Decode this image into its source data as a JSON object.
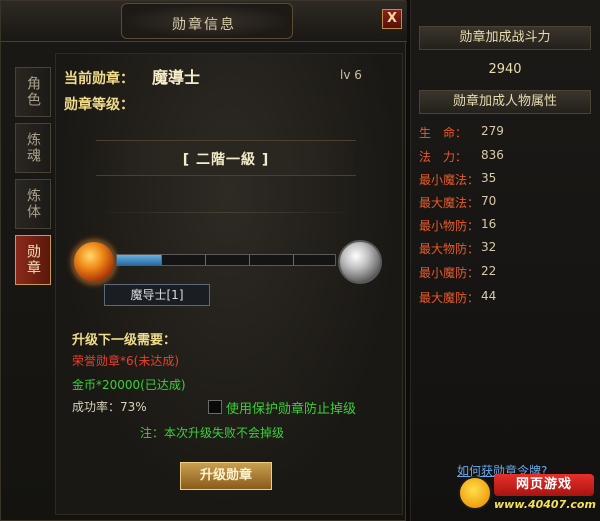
{
  "window": {
    "title": "勋章信息",
    "close_label": "X"
  },
  "tabs": [
    {
      "label": "角色",
      "active": false
    },
    {
      "label": "炼魂",
      "active": false
    },
    {
      "label": "炼体",
      "active": false
    },
    {
      "label": "勋章",
      "active": true
    }
  ],
  "medal": {
    "current_label": "当前勋章：",
    "name": "魔導士",
    "level": "lv 6",
    "level_label": "勋章等级：",
    "rank": "[ 二階一級 ]",
    "progress_fraction": 0.2,
    "progress_tooltip": "魔导士[1]"
  },
  "requirements": {
    "title": "升级下一级需要：",
    "items": [
      {
        "text": "荣誉勋章*6(未达成)",
        "status": "unmet"
      },
      {
        "text": "金币*20000(已达成)",
        "status": "met"
      }
    ],
    "success_rate": "成功率：73%",
    "protect_label": "使用保护勋章防止掉级",
    "protect_checked": false,
    "note": "注：本次升级失败不会掉级",
    "upgrade_button": "升级勋章"
  },
  "right_panel": {
    "power_header": "勋章加成战斗力",
    "power_value": "2940",
    "attr_header": "勋章加成人物属性",
    "attributes": [
      {
        "name": "生　命：",
        "value": "279"
      },
      {
        "name": "法　力：",
        "value": "836"
      },
      {
        "name": "最小魔法：",
        "value": "35"
      },
      {
        "name": "最大魔法：",
        "value": "70"
      },
      {
        "name": "最小物防：",
        "value": "16"
      },
      {
        "name": "最大物防：",
        "value": "32"
      },
      {
        "name": "最小魔防：",
        "value": "22"
      },
      {
        "name": "最大魔防：",
        "value": "44"
      }
    ],
    "help_link": "如何获勋章令牌?"
  },
  "watermark": {
    "brand": "网页游戏",
    "url": "www.40407.com"
  },
  "colors": {
    "accent_gold": "#f0dc8a",
    "unmet_red": "#e8402a",
    "met_green": "#38d038",
    "attr_red": "#e85a2a"
  }
}
